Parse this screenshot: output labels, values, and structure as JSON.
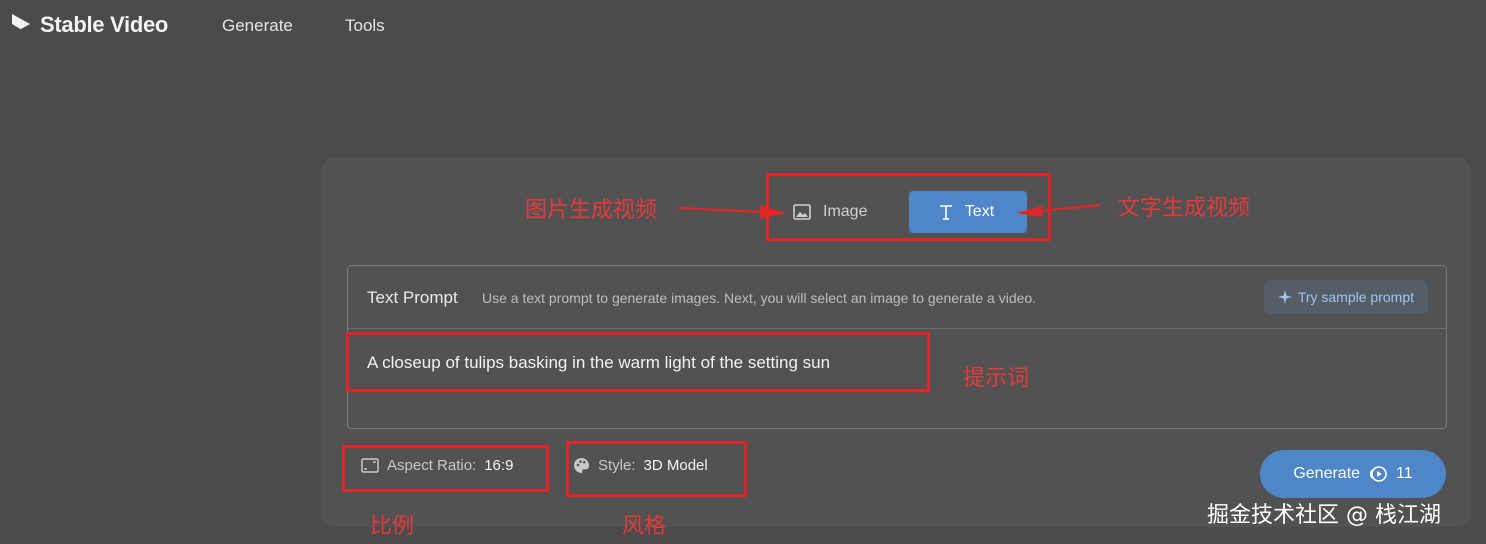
{
  "header": {
    "app_name": "Stable Video",
    "nav": [
      {
        "label": "Generate"
      },
      {
        "label": "Tools"
      }
    ]
  },
  "mode": {
    "image_label": "Image",
    "text_label": "Text",
    "active": "Text"
  },
  "prompt": {
    "label": "Text Prompt",
    "description": "Use a text prompt to generate images. Next, you will select an image to generate a video.",
    "sample_label": "Try sample prompt",
    "value": "A closeup of tulips basking in the warm light of the setting sun"
  },
  "options": {
    "aspect_label": "Aspect Ratio:",
    "aspect_value": "16:9",
    "style_label": "Style:",
    "style_value": "3D Model"
  },
  "generate": {
    "label": "Generate",
    "credits": "11"
  },
  "annotations": {
    "image_to_video": "图片生成视频",
    "text_to_video": "文字生成视频",
    "prompt": "提示词",
    "ratio": "比例",
    "style": "风格",
    "watermark": "掘金技术社区 @ 栈江湖",
    "color": "#e02626"
  },
  "colors": {
    "accent": "#4e86c7",
    "background": "#4b4b4b",
    "card": "#525252"
  }
}
